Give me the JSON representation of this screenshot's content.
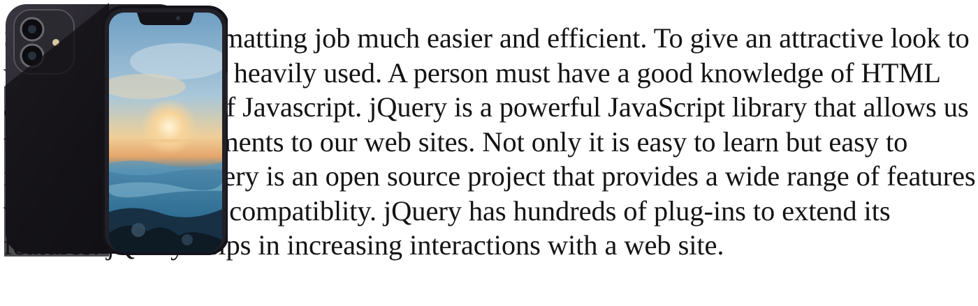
{
  "article": {
    "paragraph": "Styles make the formatting job much easier and efficient. To give an attractive look to web sites, styles are heavily used. A person must have a good knowledge of HTML and CSS and a bit of Javascript. jQuery is a powerful JavaScript library that allows us to add dynamic elements to our web sites. Not only it is easy to learn but easy to implement too. jQuery is an open source project that provides a wide range of features with cross platform compatiblity. jQuery has hundreds of plug-ins to extend its features. jQuery helps in increasing interactions with a web site."
  },
  "image": {
    "icon": "smartphone-icon",
    "colors": {
      "body": "#1c1a22",
      "sky": "#7fb0d0",
      "sun": "#f3c98c",
      "sea": "#2f6e93"
    }
  }
}
